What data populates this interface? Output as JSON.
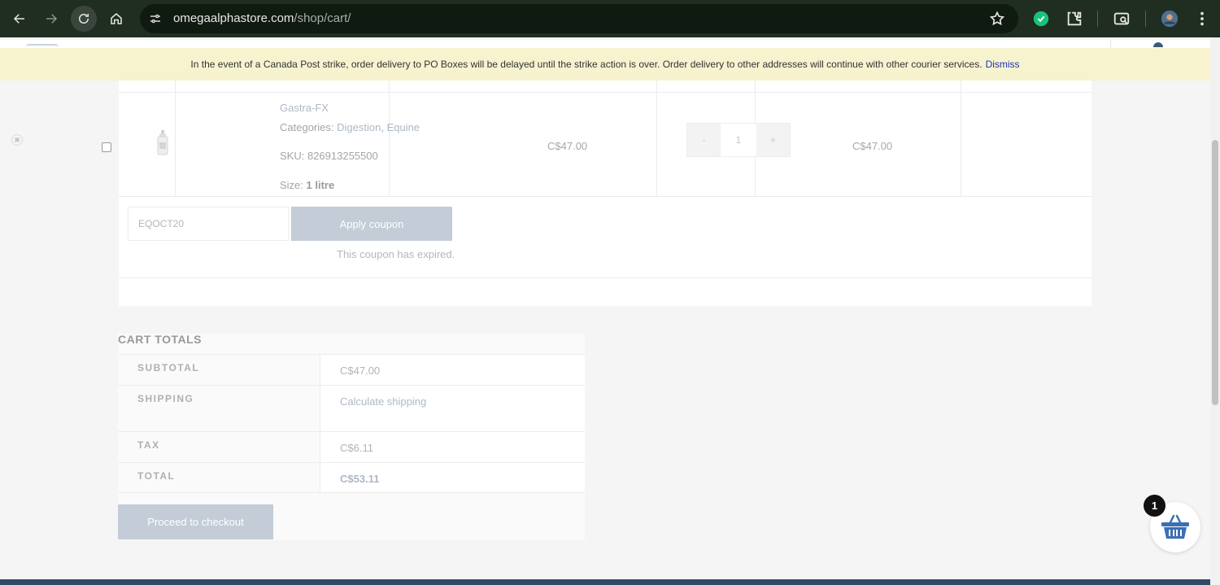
{
  "browser": {
    "url_host": "omegaalphastore.com",
    "url_path": "/shop/cart/"
  },
  "notice": {
    "text": "In the event of a Canada Post strike, order delivery to PO Boxes will be delayed until the strike action is over. Order delivery to other addresses will continue with other courier services.",
    "dismiss_label": "Dismiss"
  },
  "cart": {
    "items": [
      {
        "name": "Gastra-FX",
        "categories_label": "Categories:",
        "category_1": "Digestion",
        "category_sep": ",",
        "category_2": "Equine",
        "sku": "SKU: 826913255500",
        "size_label": "Size:",
        "size_value": "1 litre",
        "price": "C$47.00",
        "quantity": "1",
        "qty_minus": "-",
        "qty_plus": "+",
        "subtotal": "C$47.00",
        "remove_glyph": "✖"
      }
    ]
  },
  "coupon": {
    "code": "EQOCT20",
    "apply_label": "Apply coupon",
    "message": "This coupon has expired."
  },
  "totals": {
    "title": "CART TOTALS",
    "rows": [
      {
        "label": "SUBTOTAL",
        "value": "C$47.00"
      },
      {
        "label": "SHIPPING",
        "value": "Calculate shipping"
      },
      {
        "label": "TAX",
        "value": "C$6.11"
      },
      {
        "label": "TOTAL",
        "value": "C$53.11"
      }
    ],
    "checkout_label": "Proceed to checkout"
  },
  "floating_cart": {
    "count": "1"
  },
  "colors": {
    "chrome": "#1f2e21",
    "notice_bg": "#f7f3cf",
    "button_bg": "#c3ccd7",
    "footer": "#2f4a66",
    "cart_icon": "#3b6fb6"
  }
}
